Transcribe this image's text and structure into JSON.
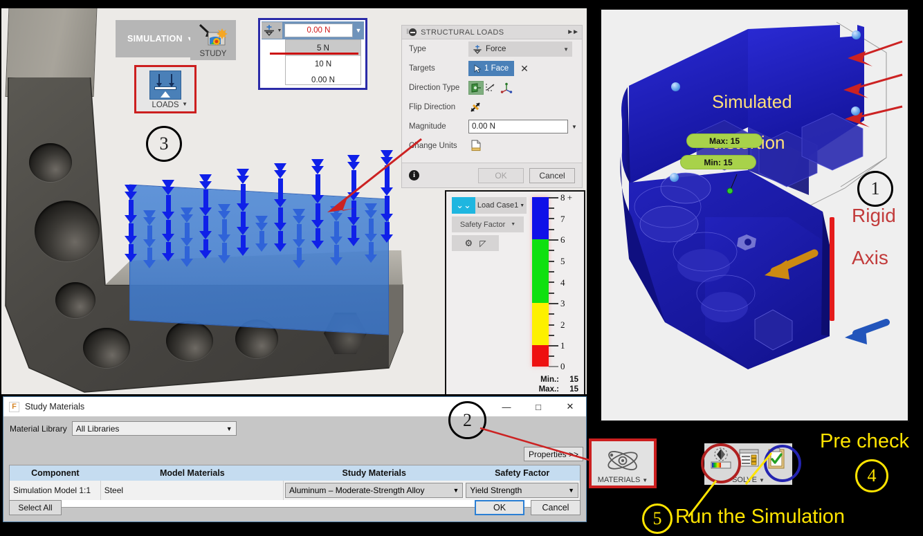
{
  "app": {
    "ribbon": {
      "simulation_tab": "SIMULATION",
      "study_label": "STUDY",
      "loads_label": "LOADS",
      "materials_label": "MATERIALS",
      "solve_label": "SOLVE"
    },
    "magnitude_dropdown": {
      "current_value": "0.00 N",
      "options": [
        "5 N",
        "10 N",
        "0.00 N"
      ],
      "selected_option": "5 N",
      "value_color": "#d01515"
    }
  },
  "structural_loads": {
    "header": "STRUCTURAL LOADS",
    "rows": [
      {
        "label": "Type",
        "value": "Force"
      },
      {
        "label": "Targets",
        "value": "1 Face"
      },
      {
        "label": "Direction Type",
        "value": ""
      },
      {
        "label": "Flip Direction",
        "value": ""
      },
      {
        "label": "Magnitude",
        "value": "0.00 N"
      },
      {
        "label": "Change Units",
        "value": ""
      }
    ],
    "ok_label": "OK",
    "cancel_label": "Cancel"
  },
  "legend": {
    "load_case": "Load Case1",
    "result_type": "Safety Factor",
    "min_label": "Min.:",
    "max_label": "Max.:",
    "min_value": "15",
    "max_value": "15",
    "ticks": [
      "8 +",
      "7",
      "6",
      "5",
      "4",
      "3",
      "2",
      "1",
      "0"
    ],
    "bands": [
      {
        "color": "#1010e8",
        "from": 6,
        "to": 8
      },
      {
        "color": "#10e010",
        "from": 3,
        "to": 6
      },
      {
        "color": "#fdf000",
        "from": 1,
        "to": 3
      },
      {
        "color": "#ee1010",
        "from": 0,
        "to": 1
      }
    ]
  },
  "viewport_right": {
    "annotation_line1": "Simulated",
    "annotation_line2": "distortion",
    "max_pill": "Max: 15",
    "min_pill": "Min: 15",
    "rigid_text": "Rigid",
    "axis_text": "Axis"
  },
  "study_materials": {
    "window_title": "Study Materials",
    "material_library_label": "Material Library",
    "material_library_value": "All Libraries",
    "properties_button": "Properties >>",
    "columns": [
      "Component",
      "Model Materials",
      "Study Materials",
      "Safety Factor"
    ],
    "rows": [
      {
        "component": "Simulation Model 1:1",
        "model_material": "Steel",
        "study_material": "Aluminum – Moderate-Strength Alloy",
        "safety_factor": "Yield Strength"
      }
    ],
    "select_all_label": "Select All",
    "ok_label": "OK",
    "cancel_label": "Cancel",
    "minimize_glyph": "—",
    "maximize_glyph": "□",
    "close_glyph": "✕"
  },
  "callouts": {
    "one": "1",
    "two": "2",
    "three": "3",
    "four": "4",
    "five": "5",
    "pre_check": "Pre  check",
    "run_simulation": "Run the Simulation"
  },
  "colors": {
    "accent_blue": "#4a80b8",
    "callout_red": "#cc1f1f",
    "callout_blue": "#2b2ba8",
    "callout_yellow": "#ffe400",
    "value_red": "#d01515"
  }
}
